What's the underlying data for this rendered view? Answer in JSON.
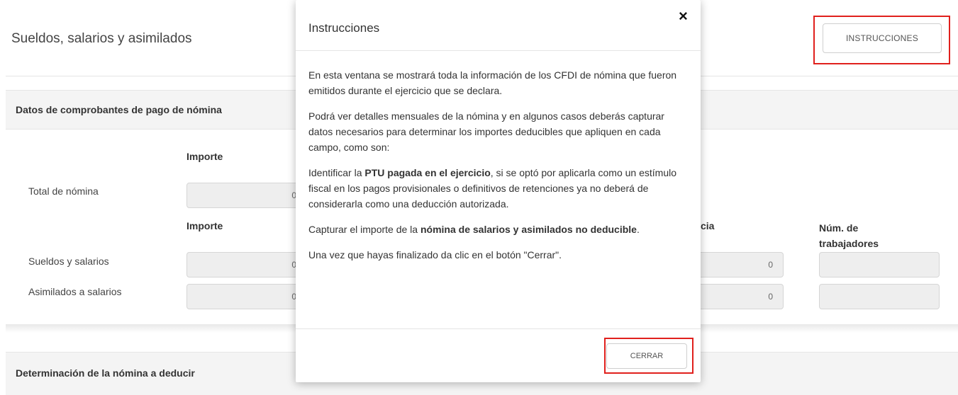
{
  "page": {
    "title": "Sueldos, salarios y asimilados",
    "instructions_button": "INSTRUCCIONES"
  },
  "section1": {
    "title": "Datos de comprobantes de pago de nómina",
    "importe_header_1": "Importe",
    "total_nomina_label": "Total de nómina",
    "importe_header_2": "Importe",
    "partial_header": "cia",
    "num_trabajadores_header": "Núm. de trabajadores",
    "rows": [
      {
        "label": "Sueldos y salarios",
        "partial_value": "0"
      },
      {
        "label": "Asimilados a salarios",
        "partial_value": "0"
      }
    ],
    "clipped_digit": "0"
  },
  "section2": {
    "title": "Determinación de la nómina a deducir"
  },
  "modal": {
    "title": "Instrucciones",
    "close_glyph": "×",
    "p1": "En esta ventana se mostrará toda la información de los CFDI de nómina que fueron emitidos durante el ejercicio que se declara.",
    "p2": "Podrá ver detalles mensuales de la nómina y en algunos casos deberás capturar datos necesarios para determinar los importes deducibles que apliquen en cada campo, como son:",
    "p3_pre": "Identificar la ",
    "p3_bold": "PTU pagada en el ejercicio",
    "p3_post": ", si se optó por aplicarla como un estímulo fiscal en los pagos provisionales o definitivos de retenciones ya no deberá de considerarla como una deducción autorizada.",
    "p4_pre": "Capturar el importe de la ",
    "p4_bold": "nómina de salarios y asimilados no deducible",
    "p4_post": ".",
    "p5": "Una vez que hayas finalizado da clic en el botón \"Cerrar\".",
    "close_button": "CERRAR"
  },
  "colors": {
    "highlight": "#e0201d",
    "section_band": "#f4f4f4",
    "field_bg": "#eeeeee"
  }
}
